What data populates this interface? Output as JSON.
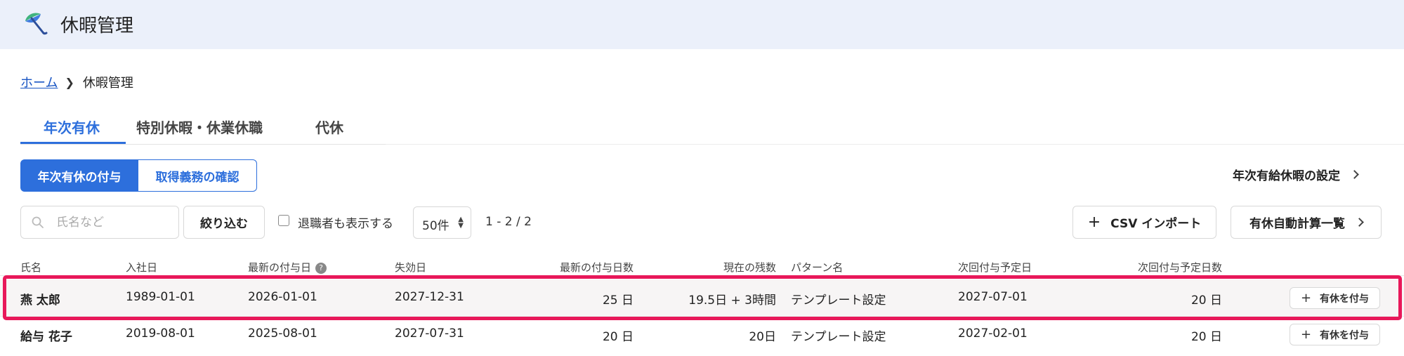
{
  "app": {
    "title": "休暇管理"
  },
  "breadcrumb": {
    "home": "ホーム",
    "current": "休暇管理"
  },
  "tabs": [
    {
      "label": "年次有休",
      "active": true
    },
    {
      "label": "特別休暇・休業休職",
      "active": false
    },
    {
      "label": "代休",
      "active": false
    }
  ],
  "segment": {
    "grant": "年次有休の付与",
    "check": "取得義務の確認"
  },
  "settings_link": "年次有給休暇の設定",
  "search": {
    "placeholder": "氏名など",
    "value": ""
  },
  "filter_button": "絞り込む",
  "show_retired": {
    "label": "退職者も表示する",
    "checked": false
  },
  "per_page": {
    "selected": "50件"
  },
  "range": "1 - 2 / 2",
  "csv_button": "CSV インポート",
  "auto_calc_button": "有休自動計算一覧",
  "table": {
    "headers": [
      "氏名",
      "入社日",
      "最新の付与日",
      "失効日",
      "最新の付与日数",
      "現在の残数",
      "パターン名",
      "次回付与予定日",
      "次回付与予定日数"
    ],
    "rows": [
      {
        "name": "燕 太郎",
        "hire_date": "1989-01-01",
        "latest_grant": "2026-01-01",
        "expiry": "2027-12-31",
        "latest_days": "25 日",
        "remaining": "19.5日 + 3時間",
        "pattern": "テンプレート設定",
        "next_date": "2027-07-01",
        "next_days": "20 日",
        "action": "有休を付与",
        "highlighted": true
      },
      {
        "name": "給与 花子",
        "hire_date": "2019-08-01",
        "latest_grant": "2025-08-01",
        "expiry": "2027-07-31",
        "latest_days": "20 日",
        "remaining": "20日",
        "pattern": "テンプレート設定",
        "next_date": "2027-02-01",
        "next_days": "20 日",
        "action": "有休を付与",
        "highlighted": false
      }
    ]
  },
  "colors": {
    "accent": "#2d6fdc",
    "highlight": "#e8185a",
    "header_bg": "#ebf0fa"
  }
}
